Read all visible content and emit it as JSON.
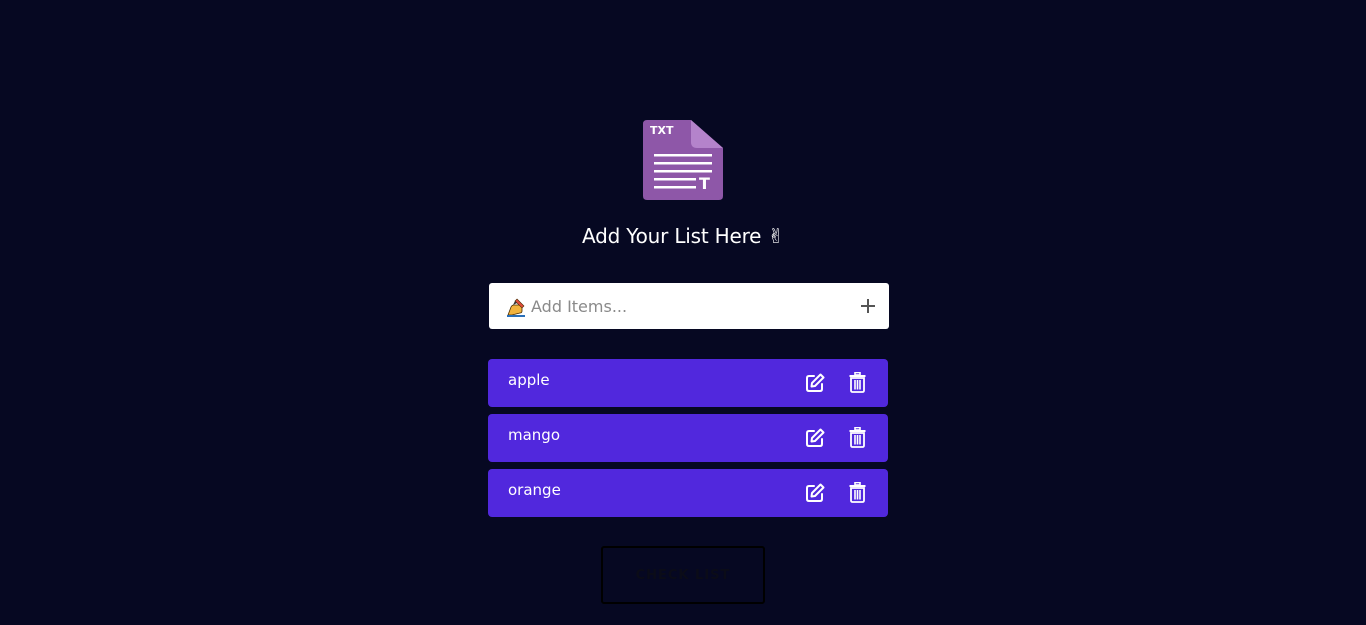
{
  "header": {
    "logo_icon": "txt-file-icon",
    "logo_text": "TXT",
    "logo_letter": "T",
    "title": "Add Your List Here ✌"
  },
  "add_item": {
    "icon": "writing-hand-icon",
    "placeholder": "Add Items...",
    "value": "",
    "add_icon": "plus-icon"
  },
  "items": [
    {
      "label": "apple",
      "edit_icon": "edit-icon",
      "delete_icon": "trash-icon"
    },
    {
      "label": "mango",
      "edit_icon": "edit-icon",
      "delete_icon": "trash-icon"
    },
    {
      "label": "orange",
      "edit_icon": "edit-icon",
      "delete_icon": "trash-icon"
    }
  ],
  "check_button": {
    "label": "CHECK LIST"
  },
  "colors": {
    "background": "#060822",
    "item_background": "#5128dd",
    "logo": "#8e57a8"
  }
}
